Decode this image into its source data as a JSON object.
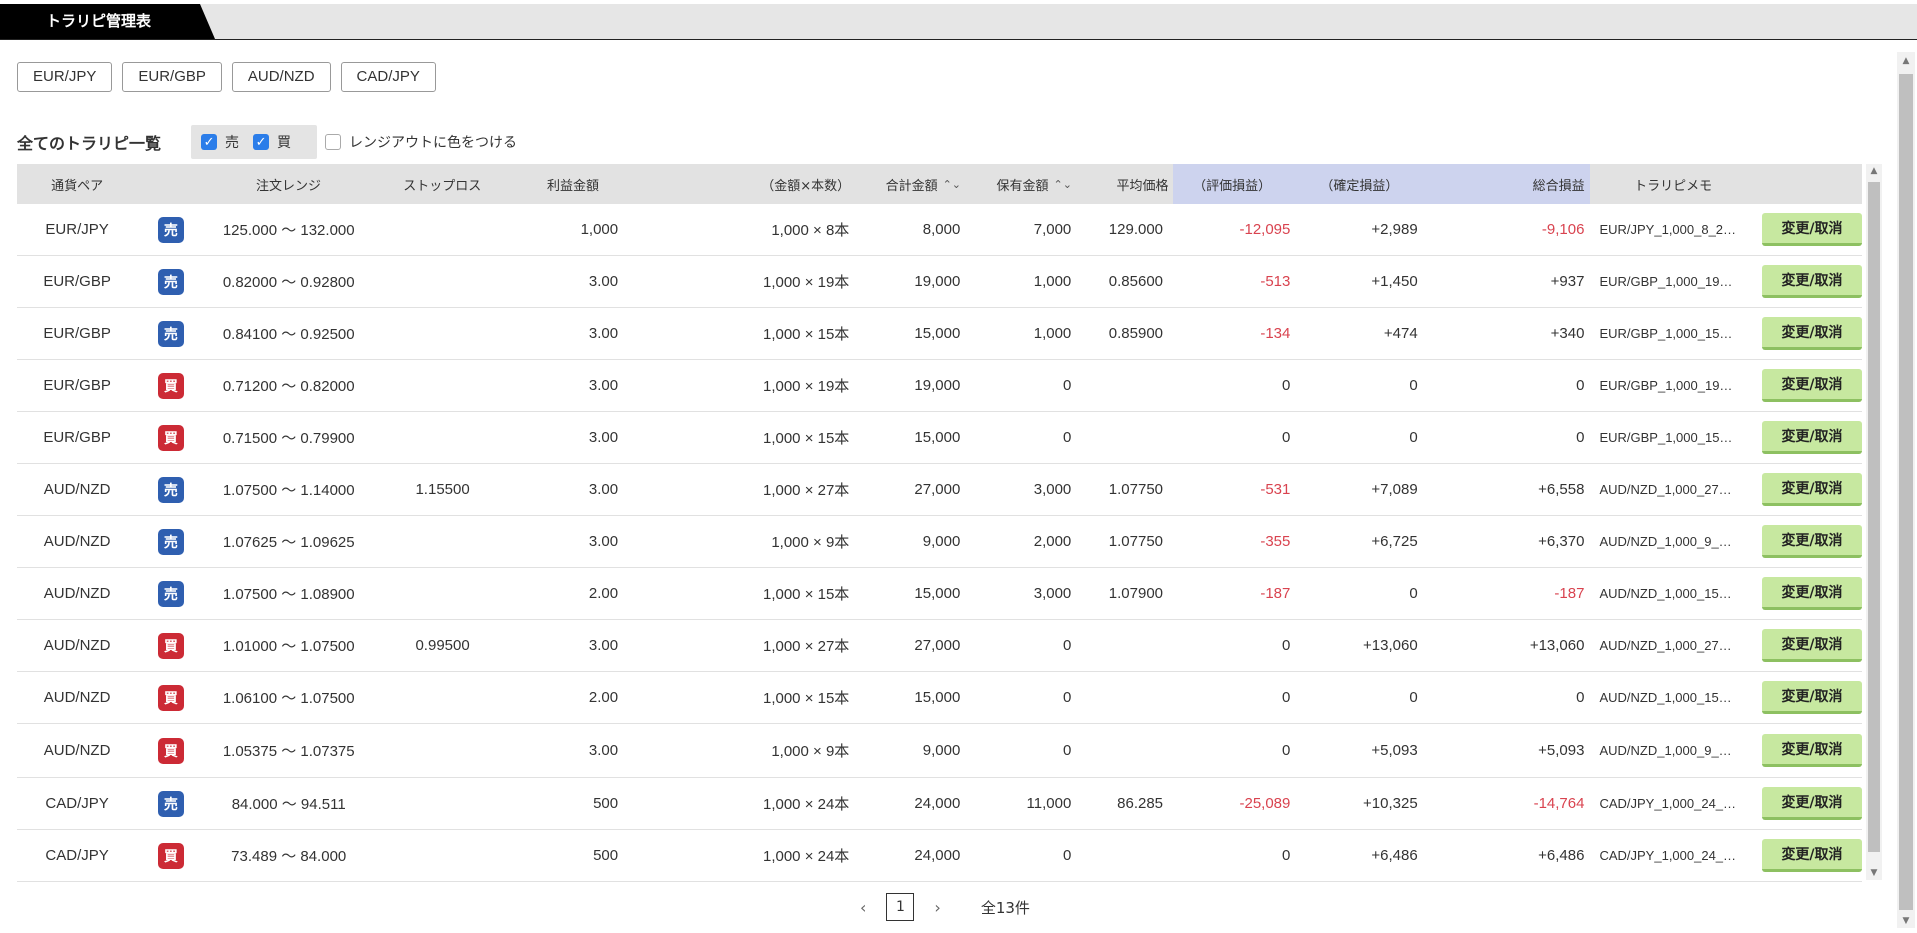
{
  "tab": {
    "label": "トラリピ管理表"
  },
  "pairs": [
    "EUR/JPY",
    "EUR/GBP",
    "AUD/NZD",
    "CAD/JPY"
  ],
  "section": {
    "title": "全てのトラリピ一覧",
    "filter_sell": "売",
    "filter_buy": "買",
    "range_color_label": "レンジアウトに色をつける"
  },
  "columns": {
    "pair": "通貨ペア",
    "range": "注文レンジ",
    "stop": "ストップロス",
    "profit": "利益金額",
    "amtqty": "（金額×本数）",
    "total": "合計金額",
    "hold": "保有金額",
    "avg": "平均価格",
    "eval": "（評価損益）",
    "fixed": "（確定損益）",
    "totpl": "総合損益",
    "memo": "トラリピメモ"
  },
  "colors": {
    "sell": "#2f5fb0",
    "buy": "#cc2a35",
    "negative": "#d9434f",
    "action": "#c7e8a0",
    "header_highlight": "#cdd3ee"
  },
  "rows": [
    {
      "pair": "EUR/JPY",
      "side": "売",
      "side_type": "sell",
      "range": "125.000 〜 132.000",
      "stop": "",
      "profit": "1,000",
      "amtqty": "1,000 × 8本",
      "total": "8,000",
      "hold": "7,000",
      "avg": "129.000",
      "eval": "-12,095",
      "eval_neg": true,
      "fixed": "+2,989",
      "totpl": "-9,106",
      "totpl_neg": true,
      "memo": "EUR/JPY_1,000_8_2…",
      "action": "変更/取消"
    },
    {
      "pair": "EUR/GBP",
      "side": "売",
      "side_type": "sell",
      "range": "0.82000 〜 0.92800",
      "stop": "",
      "profit": "3.00",
      "amtqty": "1,000 × 19本",
      "total": "19,000",
      "hold": "1,000",
      "avg": "0.85600",
      "eval": "-513",
      "eval_neg": true,
      "fixed": "+1,450",
      "totpl": "+937",
      "totpl_neg": false,
      "memo": "EUR/GBP_1,000_19…",
      "action": "変更/取消"
    },
    {
      "pair": "EUR/GBP",
      "side": "売",
      "side_type": "sell",
      "range": "0.84100 〜 0.92500",
      "stop": "",
      "profit": "3.00",
      "amtqty": "1,000 × 15本",
      "total": "15,000",
      "hold": "1,000",
      "avg": "0.85900",
      "eval": "-134",
      "eval_neg": true,
      "fixed": "+474",
      "totpl": "+340",
      "totpl_neg": false,
      "memo": "EUR/GBP_1,000_15…",
      "action": "変更/取消"
    },
    {
      "pair": "EUR/GBP",
      "side": "買",
      "side_type": "buy",
      "range": "0.71200 〜 0.82000",
      "stop": "",
      "profit": "3.00",
      "amtqty": "1,000 × 19本",
      "total": "19,000",
      "hold": "0",
      "avg": "",
      "eval": "0",
      "eval_neg": false,
      "fixed": "0",
      "totpl": "0",
      "totpl_neg": false,
      "memo": "EUR/GBP_1,000_19…",
      "action": "変更/取消"
    },
    {
      "pair": "EUR/GBP",
      "side": "買",
      "side_type": "buy",
      "range": "0.71500 〜 0.79900",
      "stop": "",
      "profit": "3.00",
      "amtqty": "1,000 × 15本",
      "total": "15,000",
      "hold": "0",
      "avg": "",
      "eval": "0",
      "eval_neg": false,
      "fixed": "0",
      "totpl": "0",
      "totpl_neg": false,
      "memo": "EUR/GBP_1,000_15…",
      "action": "変更/取消"
    },
    {
      "pair": "AUD/NZD",
      "side": "売",
      "side_type": "sell",
      "range": "1.07500 〜 1.14000",
      "stop": "1.15500",
      "profit": "3.00",
      "amtqty": "1,000 × 27本",
      "total": "27,000",
      "hold": "3,000",
      "avg": "1.07750",
      "eval": "-531",
      "eval_neg": true,
      "fixed": "+7,089",
      "totpl": "+6,558",
      "totpl_neg": false,
      "memo": "AUD/NZD_1,000_27…",
      "action": "変更/取消"
    },
    {
      "pair": "AUD/NZD",
      "side": "売",
      "side_type": "sell",
      "range": "1.07625 〜 1.09625",
      "stop": "",
      "profit": "3.00",
      "amtqty": "1,000 × 9本",
      "total": "9,000",
      "hold": "2,000",
      "avg": "1.07750",
      "eval": "-355",
      "eval_neg": true,
      "fixed": "+6,725",
      "totpl": "+6,370",
      "totpl_neg": false,
      "memo": "AUD/NZD_1,000_9_…",
      "action": "変更/取消"
    },
    {
      "pair": "AUD/NZD",
      "side": "売",
      "side_type": "sell",
      "range": "1.07500 〜 1.08900",
      "stop": "",
      "profit": "2.00",
      "amtqty": "1,000 × 15本",
      "total": "15,000",
      "hold": "3,000",
      "avg": "1.07900",
      "eval": "-187",
      "eval_neg": true,
      "fixed": "0",
      "totpl": "-187",
      "totpl_neg": true,
      "memo": "AUD/NZD_1,000_15…",
      "action": "変更/取消"
    },
    {
      "pair": "AUD/NZD",
      "side": "買",
      "side_type": "buy",
      "range": "1.01000 〜 1.07500",
      "stop": "0.99500",
      "profit": "3.00",
      "amtqty": "1,000 × 27本",
      "total": "27,000",
      "hold": "0",
      "avg": "",
      "eval": "0",
      "eval_neg": false,
      "fixed": "+13,060",
      "totpl": "+13,060",
      "totpl_neg": false,
      "memo": "AUD/NZD_1,000_27…",
      "action": "変更/取消"
    },
    {
      "pair": "AUD/NZD",
      "side": "買",
      "side_type": "buy",
      "range": "1.06100 〜 1.07500",
      "stop": "",
      "profit": "2.00",
      "amtqty": "1,000 × 15本",
      "total": "15,000",
      "hold": "0",
      "avg": "",
      "eval": "0",
      "eval_neg": false,
      "fixed": "0",
      "totpl": "0",
      "totpl_neg": false,
      "memo": "AUD/NZD_1,000_15…",
      "action": "変更/取消"
    },
    {
      "pair": "AUD/NZD",
      "side": "買",
      "side_type": "buy",
      "range": "1.05375 〜 1.07375",
      "stop": "",
      "profit": "3.00",
      "amtqty": "1,000 × 9本",
      "total": "9,000",
      "hold": "0",
      "avg": "",
      "eval": "0",
      "eval_neg": false,
      "fixed": "+5,093",
      "totpl": "+5,093",
      "totpl_neg": false,
      "memo": "AUD/NZD_1,000_9_…",
      "action": "変更/取消"
    },
    {
      "pair": "CAD/JPY",
      "side": "売",
      "side_type": "sell",
      "range": "84.000 〜 94.511",
      "stop": "",
      "profit": "500",
      "amtqty": "1,000 × 24本",
      "total": "24,000",
      "hold": "11,000",
      "avg": "86.285",
      "eval": "-25,089",
      "eval_neg": true,
      "fixed": "+10,325",
      "totpl": "-14,764",
      "totpl_neg": true,
      "memo": "CAD/JPY_1,000_24_…",
      "action": "変更/取消"
    },
    {
      "pair": "CAD/JPY",
      "side": "買",
      "side_type": "buy",
      "range": "73.489 〜 84.000",
      "stop": "",
      "profit": "500",
      "amtqty": "1,000 × 24本",
      "total": "24,000",
      "hold": "0",
      "avg": "",
      "eval": "0",
      "eval_neg": false,
      "fixed": "+6,486",
      "totpl": "+6,486",
      "totpl_neg": false,
      "memo": "CAD/JPY_1,000_24_…",
      "action": "変更/取消"
    }
  ],
  "pagination": {
    "prev_icon": "‹",
    "page": "1",
    "next_icon": "›",
    "total": "全13件"
  }
}
